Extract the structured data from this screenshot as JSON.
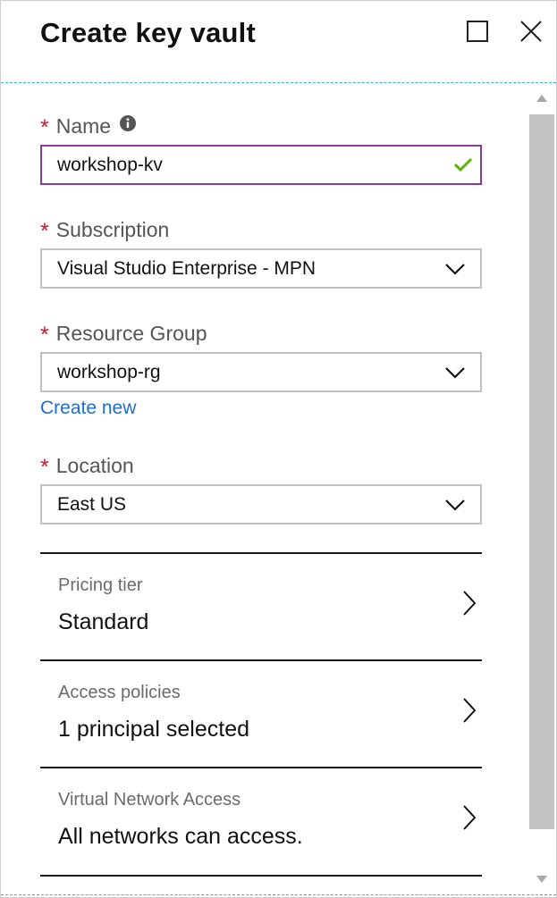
{
  "header": {
    "title": "Create key vault"
  },
  "form": {
    "name": {
      "label": "Name",
      "value": "workshop-kv",
      "valid": true
    },
    "subscription": {
      "label": "Subscription",
      "value": "Visual Studio Enterprise - MPN"
    },
    "resource_group": {
      "label": "Resource Group",
      "value": "workshop-rg",
      "create_new_link": "Create new"
    },
    "location": {
      "label": "Location",
      "value": "East US"
    },
    "required_marker": "*"
  },
  "nav_items": [
    {
      "label": "Pricing tier",
      "value": "Standard"
    },
    {
      "label": "Access policies",
      "value": "1 principal selected"
    },
    {
      "label": "Virtual Network Access",
      "value": "All networks can access."
    }
  ],
  "icons": {
    "info": "info-icon",
    "valid": "check-icon",
    "dropdown": "chevron-down-icon",
    "navigate": "chevron-right-icon",
    "maximize": "maximize-icon",
    "close": "close-icon"
  },
  "colors": {
    "required": "#d8122a",
    "link": "#1f6fc9",
    "active_border": "#8a3b9c",
    "valid_check": "#5cb200",
    "divider_accent": "#36b3d6"
  }
}
